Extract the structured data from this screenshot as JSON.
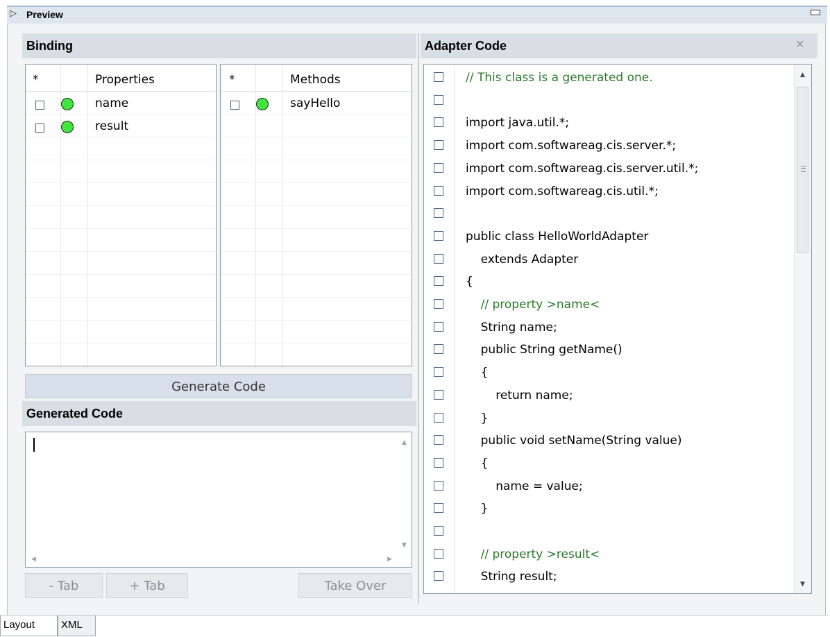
{
  "window": {
    "title": "Preview"
  },
  "binding": {
    "title": "Binding",
    "properties": {
      "star": "*",
      "header": "Properties",
      "rows": [
        "name",
        "result"
      ]
    },
    "methods": {
      "star": "*",
      "header": "Methods",
      "rows": [
        "sayHello"
      ]
    },
    "status_color": "#3ee63e"
  },
  "generate_button": "Generate Code",
  "generated_code": {
    "title": "Generated Code",
    "value": ""
  },
  "buttons": {
    "minus_tab": "- Tab",
    "plus_tab": "+ Tab",
    "take_over": "Take Over"
  },
  "adapter_code": {
    "title": "Adapter Code",
    "lines": [
      {
        "text": "// This class is a generated one.",
        "comment": true
      },
      {
        "text": "",
        "comment": false
      },
      {
        "text": "import java.util.*;",
        "comment": false
      },
      {
        "text": "import com.softwareag.cis.server.*;",
        "comment": false
      },
      {
        "text": "import com.softwareag.cis.server.util.*;",
        "comment": false
      },
      {
        "text": "import com.softwareag.cis.util.*;",
        "comment": false
      },
      {
        "text": "",
        "comment": false
      },
      {
        "text": "public class HelloWorldAdapter",
        "comment": false
      },
      {
        "text": "    extends Adapter",
        "comment": false
      },
      {
        "text": "{",
        "comment": false
      },
      {
        "text": "    // property >name<",
        "comment": true
      },
      {
        "text": "    String name;",
        "comment": false
      },
      {
        "text": "    public String getName()",
        "comment": false
      },
      {
        "text": "    {",
        "comment": false
      },
      {
        "text": "        return name;",
        "comment": false
      },
      {
        "text": "    }",
        "comment": false
      },
      {
        "text": "    public void setName(String value)",
        "comment": false
      },
      {
        "text": "    {",
        "comment": false
      },
      {
        "text": "        name = value;",
        "comment": false
      },
      {
        "text": "    }",
        "comment": false
      },
      {
        "text": "",
        "comment": false
      },
      {
        "text": "    // property >result<",
        "comment": true
      },
      {
        "text": "    String result;",
        "comment": false
      }
    ]
  },
  "bottom_tabs": [
    "Layout",
    "XML"
  ]
}
